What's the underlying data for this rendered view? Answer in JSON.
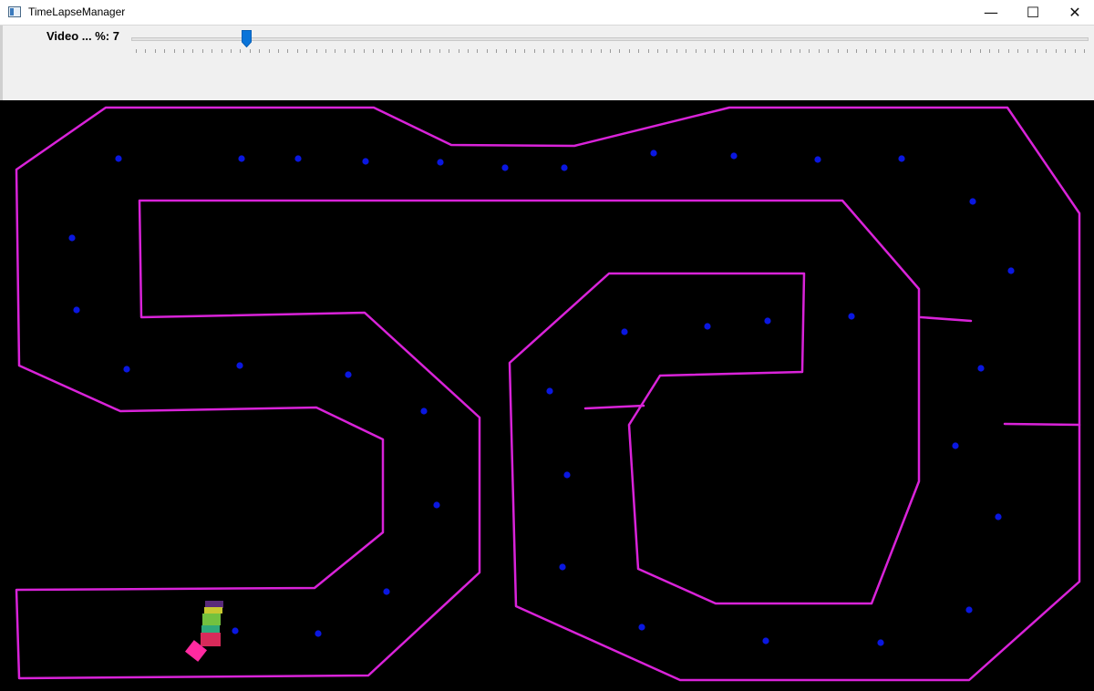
{
  "window": {
    "title": "TimeLapseManager",
    "minimize_glyph": "—",
    "maximize_glyph": "☐",
    "close_glyph": "✕"
  },
  "slider": {
    "label": "Video ... %: 7",
    "value_percent": 7,
    "thumb_color": "#0a74d9",
    "tick_count": 100
  },
  "track": {
    "boundary_color": "#d923d9",
    "background_color": "#000000",
    "waypoint_color": "#0a17e0"
  },
  "waypoints_count": 41,
  "cars": [
    {
      "color": "#5a2a7a"
    },
    {
      "color": "#c8c830"
    },
    {
      "color": "#73c13f"
    },
    {
      "color": "#2fa87a"
    },
    {
      "color": "#d82a5a"
    },
    {
      "color": "#ff2aa0"
    }
  ]
}
